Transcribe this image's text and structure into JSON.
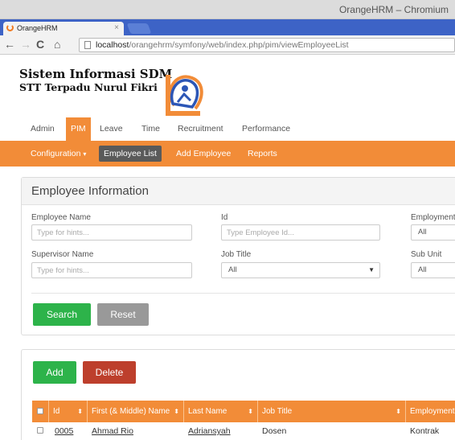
{
  "window": {
    "title": "OrangeHRM – Chromium"
  },
  "browser": {
    "tab_label": "OrangeHRM",
    "tab_close": "×",
    "url_host": "localhost",
    "url_path": "/orangehrm/symfony/web/index.php/pim/viewEmployeeList"
  },
  "header": {
    "line1": "Sistem Informasi SDM",
    "line2": "STT Terpadu Nurul Fikri"
  },
  "menu": {
    "items": [
      "Admin",
      "PIM",
      "Leave",
      "Time",
      "Recruitment",
      "Performance"
    ],
    "active": "PIM"
  },
  "submenu": {
    "configuration": "Configuration",
    "configuration_caret": "▾",
    "employee_list": "Employee List",
    "add_employee": "Add Employee",
    "reports": "Reports"
  },
  "search_panel": {
    "title": "Employee Information",
    "employee_name": {
      "label": "Employee Name",
      "placeholder": "Type for hints..."
    },
    "id": {
      "label": "Id",
      "placeholder": "Type Employee Id..."
    },
    "employment_status": {
      "label": "Employment",
      "value": "All"
    },
    "supervisor_name": {
      "label": "Supervisor Name",
      "placeholder": "Type for hints..."
    },
    "job_title": {
      "label": "Job Title",
      "value": "All"
    },
    "sub_unit": {
      "label": "Sub Unit",
      "value": "All"
    },
    "search_button": "Search",
    "reset_button": "Reset"
  },
  "list_panel": {
    "add_button": "Add",
    "delete_button": "Delete",
    "columns": [
      "Id",
      "First (& Middle) Name",
      "Last Name",
      "Job Title",
      "Employment"
    ],
    "sort_glyph": "⬍",
    "rows": [
      {
        "id": "0005",
        "first_name": "Ahmad Rio",
        "last_name": "Adriansyah",
        "job_title": "Dosen",
        "employment": "Kontrak"
      }
    ]
  },
  "colors": {
    "accent": "#f28c38",
    "success": "#2db34a",
    "danger": "#bd3f2c",
    "neutral": "#999999"
  }
}
